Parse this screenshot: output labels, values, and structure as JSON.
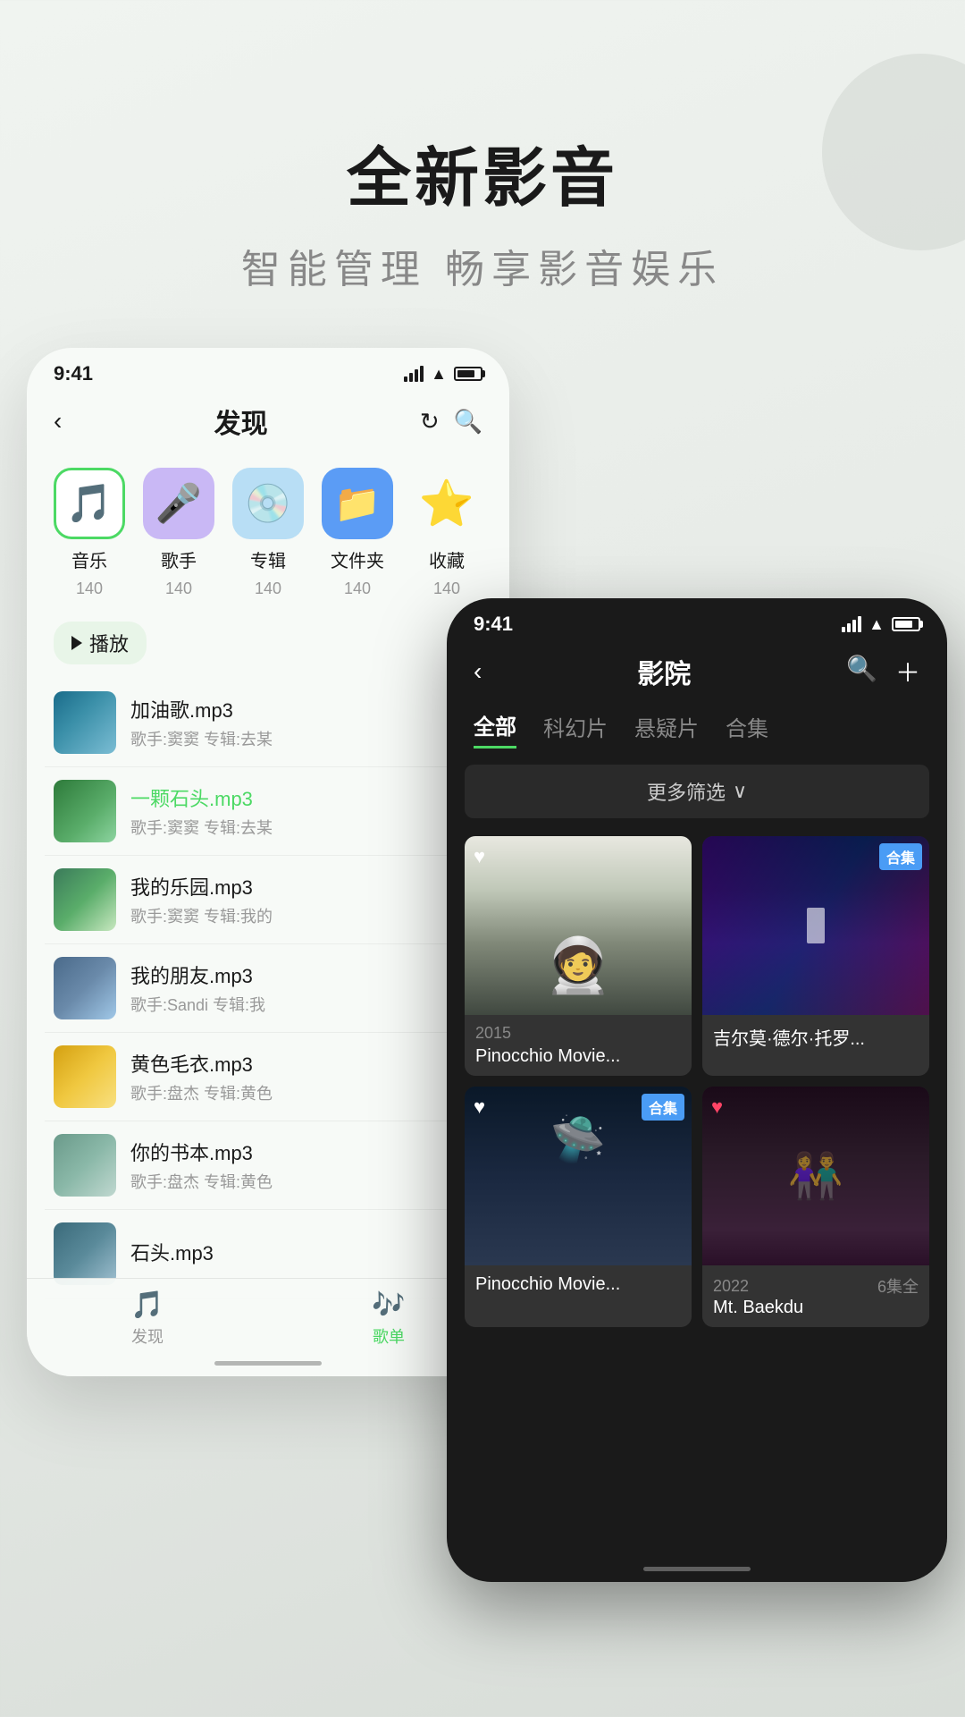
{
  "hero": {
    "title": "全新影音",
    "subtitle": "智能管理  畅享影音娱乐"
  },
  "left_phone": {
    "status_time": "9:41",
    "nav_title": "发现",
    "categories": [
      {
        "label": "音乐",
        "count": "140",
        "icon": "🎵"
      },
      {
        "label": "歌手",
        "count": "140",
        "icon": "🎤"
      },
      {
        "label": "专辑",
        "count": "140",
        "icon": "💿"
      },
      {
        "label": "文件夹",
        "count": "140",
        "icon": "📁"
      },
      {
        "label": "收藏",
        "count": "140",
        "icon": "⭐"
      }
    ],
    "play_button": "播放",
    "songs": [
      {
        "title": "加油歌.mp3",
        "meta": "歌手:窦窦  专辑:去某",
        "color": "normal"
      },
      {
        "title": "一颗石头.mp3",
        "meta": "歌手:窦窦  专辑:去某",
        "color": "green"
      },
      {
        "title": "我的乐园.mp3",
        "meta": "歌手:窦窦  专辑:我的",
        "color": "normal"
      },
      {
        "title": "我的朋友.mp3",
        "meta": "歌手:Sandi  专辑:我",
        "color": "normal"
      },
      {
        "title": "黄色毛衣.mp3",
        "meta": "歌手:盘杰  专辑:黄色",
        "color": "normal"
      },
      {
        "title": "你的书本.mp3",
        "meta": "歌手:盘杰  专辑:黄色",
        "color": "normal"
      },
      {
        "title": "石头.mp3",
        "meta": "",
        "color": "normal"
      }
    ],
    "bottom_nav": [
      {
        "label": "发现",
        "icon": "🎵"
      },
      {
        "label": "歌单",
        "icon": "🎶"
      }
    ]
  },
  "right_phone": {
    "status_time": "9:41",
    "nav_title": "影院",
    "tabs": [
      {
        "label": "全部",
        "active": true
      },
      {
        "label": "科幻片",
        "active": false
      },
      {
        "label": "悬疑片",
        "active": false
      },
      {
        "label": "合集",
        "active": false
      }
    ],
    "filter_label": "更多筛选",
    "movies": [
      {
        "title": "Pinocchio Movie...",
        "year": "2015",
        "badge": "",
        "has_heart": true
      },
      {
        "title": "吉尔莫·德尔·托罗...",
        "year": "",
        "badge": "合集",
        "has_heart": false
      },
      {
        "title": "Pinocchio Movie...",
        "year": "",
        "badge": "合集",
        "has_heart": true
      },
      {
        "title": "Mt. Baekdu",
        "year": "2022",
        "badge": "",
        "episodes": "6集全",
        "has_heart": false
      }
    ]
  }
}
